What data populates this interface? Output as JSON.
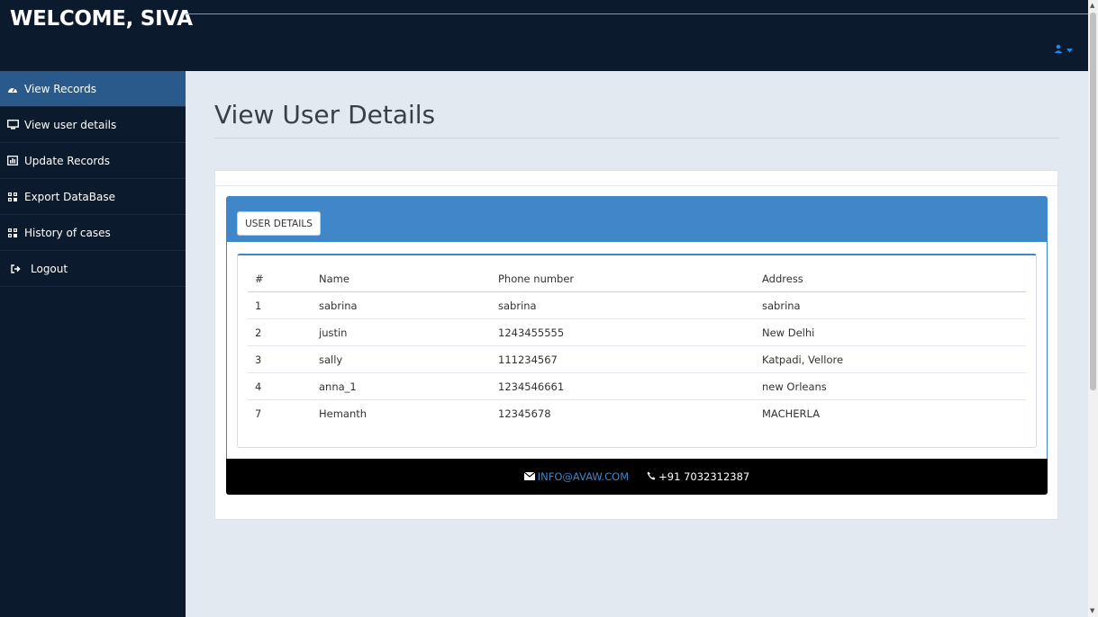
{
  "header": {
    "welcome": "WELCOME, SIVA"
  },
  "sidebar": {
    "items": [
      {
        "label": "View Records",
        "icon": "dashboard-icon",
        "active": true
      },
      {
        "label": "View user details",
        "icon": "desktop-icon",
        "active": false
      },
      {
        "label": "Update Records",
        "icon": "bar-chart-icon",
        "active": false
      },
      {
        "label": "Export DataBase",
        "icon": "grid-icon",
        "active": false
      },
      {
        "label": "History of cases",
        "icon": "grid-icon",
        "active": false
      },
      {
        "label": "Logout",
        "icon": "sign-out-icon",
        "active": false
      }
    ]
  },
  "main": {
    "title": "View User Details",
    "panel_button": "USER DETAILS",
    "table": {
      "headers": [
        "#",
        "Name",
        "Phone number",
        "Address"
      ],
      "rows": [
        [
          "1",
          "sabrina",
          "sabrina",
          "sabrina"
        ],
        [
          "2",
          "justin",
          "1243455555",
          "New Delhi"
        ],
        [
          "3",
          "sally",
          "111234567",
          "Katpadi, Vellore"
        ],
        [
          "4",
          "anna_1",
          "1234546661",
          "new Orleans"
        ],
        [
          "7",
          "Hemanth",
          "12345678",
          "MACHERLA"
        ]
      ]
    },
    "footer": {
      "email": "INFO@AVAW.COM",
      "phone": "+91 7032312387"
    }
  },
  "colors": {
    "navbar": "#0c1a2d",
    "accent": "#3f87c8",
    "active_item": "#2a5a8c",
    "background": "#e3e9f1"
  }
}
